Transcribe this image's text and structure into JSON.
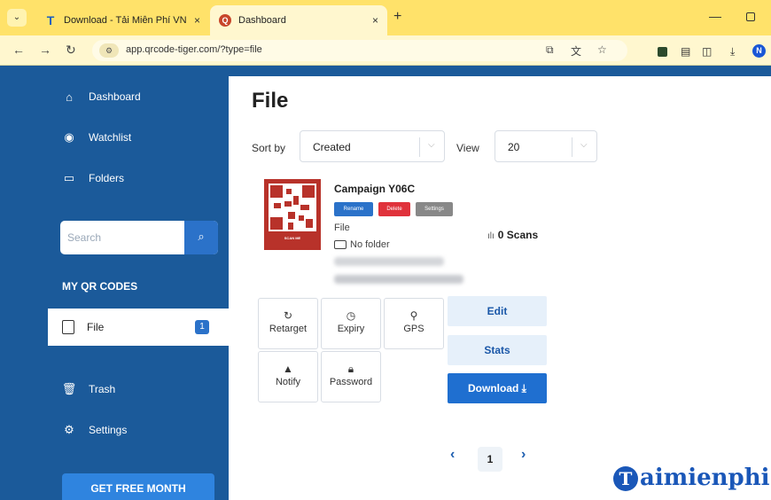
{
  "browser": {
    "tabs": [
      {
        "title": "Download - Tải Miễn Phí VN - ",
        "favicon": "T",
        "close": "×"
      },
      {
        "title": "Dashboard",
        "favicon": "Q",
        "close": "×"
      }
    ],
    "new_tab": "+",
    "url": "app.qrcode-tiger.com/?type=file",
    "accent": "#ffe26a"
  },
  "sidebar": {
    "items_top": [
      {
        "label": "Dashboard",
        "icon": "home-icon"
      },
      {
        "label": "Watchlist",
        "icon": "eye-icon"
      },
      {
        "label": "Folders",
        "icon": "folder-icon"
      }
    ],
    "search_placeholder": "Search",
    "section_label": "MY QR CODES",
    "active_item": {
      "label": "File",
      "badge": "1"
    },
    "items_bottom": [
      {
        "label": "Trash",
        "icon": "trash-icon"
      },
      {
        "label": "Settings",
        "icon": "gear-icon"
      }
    ],
    "cta": "GET FREE MONTH",
    "bg_color": "#1b5a9a"
  },
  "main": {
    "title": "File",
    "sort_label": "Sort by",
    "sort_value": "Created",
    "view_label": "View",
    "view_value": "20",
    "campaign": {
      "name": "Campaign Y06C",
      "actions": [
        "Rename",
        "Delete",
        "Settings"
      ],
      "type": "File",
      "folder": "No folder",
      "scans": "0 Scans",
      "qr_caption": "SCAN ME"
    },
    "tools": [
      {
        "label": "Retarget",
        "icon": "refresh-icon"
      },
      {
        "label": "Expiry",
        "icon": "clock-icon"
      },
      {
        "label": "GPS",
        "icon": "pin-icon"
      },
      {
        "label": "Notify",
        "icon": "bell-icon"
      },
      {
        "label": "Password",
        "icon": "lock-icon"
      }
    ],
    "edit": "Edit",
    "stats": "Stats",
    "download": "Download",
    "pagination": {
      "prev": "‹",
      "page": "1",
      "next": "›"
    }
  },
  "watermark": {
    "brand": "aimienphi",
    "initial": "T"
  }
}
